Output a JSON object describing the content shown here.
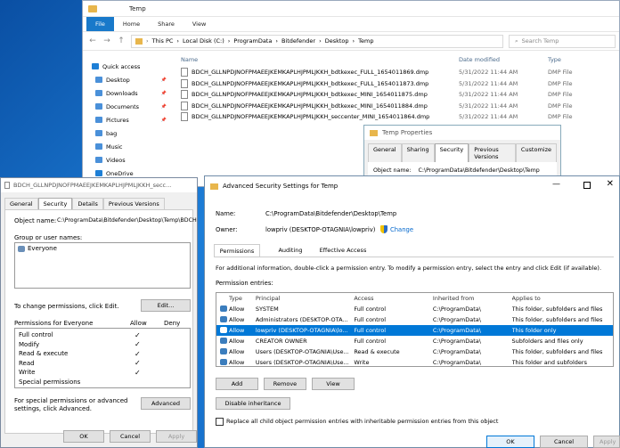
{
  "explorer": {
    "title": "Temp",
    "ribbon": [
      "File",
      "Home",
      "Share",
      "View"
    ],
    "path": [
      "This PC",
      "Local Disk (C:)",
      "ProgramData",
      "Bitdefender",
      "Desktop",
      "Temp"
    ],
    "search_placeholder": "Search Temp",
    "nav": [
      {
        "label": "Quick access",
        "pin": false
      },
      {
        "label": "Desktop",
        "pin": true
      },
      {
        "label": "Downloads",
        "pin": true
      },
      {
        "label": "Documents",
        "pin": true
      },
      {
        "label": "Pictures",
        "pin": true
      },
      {
        "label": "bag",
        "pin": false
      },
      {
        "label": "Music",
        "pin": false
      },
      {
        "label": "Videos",
        "pin": false
      },
      {
        "label": "OneDrive",
        "pin": false
      }
    ],
    "columns": [
      "Name",
      "Date modified",
      "Type"
    ],
    "files": [
      {
        "name": "BDCH_GLLNPDJNOFPMAEEJKEMKAPLHJPMLJKKH_bdtkexec_FULL_1654011869.dmp",
        "date": "5/31/2022 11:44 AM",
        "type": "DMP File"
      },
      {
        "name": "BDCH_GLLNPDJNOFPMAEEJKEMKAPLHJPMLJKKH_bdtkexec_FULL_1654011873.dmp",
        "date": "5/31/2022 11:44 AM",
        "type": "DMP File"
      },
      {
        "name": "BDCH_GLLNPDJNOFPMAEEJKEMKAPLHJPMLJKKH_bdtkexec_MINI_1654011875.dmp",
        "date": "5/31/2022 11:44 AM",
        "type": "DMP File"
      },
      {
        "name": "BDCH_GLLNPDJNOFPMAEEJKEMKAPLHJPMLJKKH_bdtkexec_MINI_1654011884.dmp",
        "date": "5/31/2022 11:44 AM",
        "type": "DMP File"
      },
      {
        "name": "BDCH_GLLNPDJNOFPMAEEJKEMKAPLHJPMLJKKH_seccenter_MINI_1654011864.dmp",
        "date": "5/31/2022 11:44 AM",
        "type": "DMP File"
      }
    ]
  },
  "temp_props": {
    "title": "Temp Properties",
    "tabs": [
      "General",
      "Sharing",
      "Security",
      "Previous Versions",
      "Customize"
    ],
    "object_label": "Object name:",
    "object_value": "C:\\ProgramData\\Bitdefender\\Desktop\\Temp"
  },
  "props": {
    "title": "BDCH_GLLNPDJNOFPMAEEJKEMKAPLHJPMLJKKH_secc...",
    "tabs": [
      "General",
      "Security",
      "Details",
      "Previous Versions"
    ],
    "object_label": "Object name:",
    "object_value": "C:\\ProgramData\\Bitdefender\\Desktop\\Temp\\BDCH",
    "group_label": "Group or user names:",
    "group_user": "Everyone",
    "change_text": "To change permissions, click Edit.",
    "edit": "Edit...",
    "perm_for": "Permissions for Everyone",
    "allow": "Allow",
    "deny": "Deny",
    "perms": [
      {
        "name": "Full control",
        "allow": true
      },
      {
        "name": "Modify",
        "allow": true
      },
      {
        "name": "Read & execute",
        "allow": true
      },
      {
        "name": "Read",
        "allow": true
      },
      {
        "name": "Write",
        "allow": true
      },
      {
        "name": "Special permissions",
        "allow": false
      }
    ],
    "special_text": "For special permissions or advanced settings, click Advanced.",
    "advanced": "Advanced",
    "ok": "OK",
    "cancel": "Cancel",
    "apply": "Apply"
  },
  "adv": {
    "title": "Advanced Security Settings for Temp",
    "name_label": "Name:",
    "name_value": "C:\\ProgramData\\Bitdefender\\Desktop\\Temp",
    "owner_label": "Owner:",
    "owner_value": "lowpriv (DESKTOP-OTAGNIA\\lowpriv)",
    "change": "Change",
    "tabs": [
      "Permissions",
      "Auditing",
      "Effective Access"
    ],
    "info": "For additional information, double-click a permission entry. To modify a permission entry, select the entry and click Edit (if available).",
    "entries_label": "Permission entries:",
    "headers": [
      "Type",
      "Principal",
      "Access",
      "Inherited from",
      "Applies to"
    ],
    "entries": [
      {
        "type": "Allow",
        "principal": "SYSTEM",
        "access": "Full control",
        "inherited": "C:\\ProgramData\\",
        "applies": "This folder, subfolders and files"
      },
      {
        "type": "Allow",
        "principal": "Administrators (DESKTOP-OTA...",
        "access": "Full control",
        "inherited": "C:\\ProgramData\\",
        "applies": "This folder, subfolders and files"
      },
      {
        "type": "Allow",
        "principal": "lowpriv (DESKTOP-OTAGNIA\\lo...",
        "access": "Full control",
        "inherited": "C:\\ProgramData\\",
        "applies": "This folder only"
      },
      {
        "type": "Allow",
        "principal": "CREATOR OWNER",
        "access": "Full control",
        "inherited": "C:\\ProgramData\\",
        "applies": "Subfolders and files only"
      },
      {
        "type": "Allow",
        "principal": "Users (DESKTOP-OTAGNIA\\Use...",
        "access": "Read & execute",
        "inherited": "C:\\ProgramData\\",
        "applies": "This folder, subfolders and files"
      },
      {
        "type": "Allow",
        "principal": "Users (DESKTOP-OTAGNIA\\Use...",
        "access": "Write",
        "inherited": "C:\\ProgramData\\",
        "applies": "This folder and subfolders"
      }
    ],
    "add": "Add",
    "remove": "Remove",
    "view": "View",
    "disable": "Disable inheritance",
    "replace": "Replace all child object permission entries with inheritable permission entries from this object",
    "ok": "OK",
    "cancel": "Cancel",
    "apply": "Apply"
  },
  "colors": {
    "accent": "#0078d7",
    "ribbon_file": "#1979ca"
  }
}
